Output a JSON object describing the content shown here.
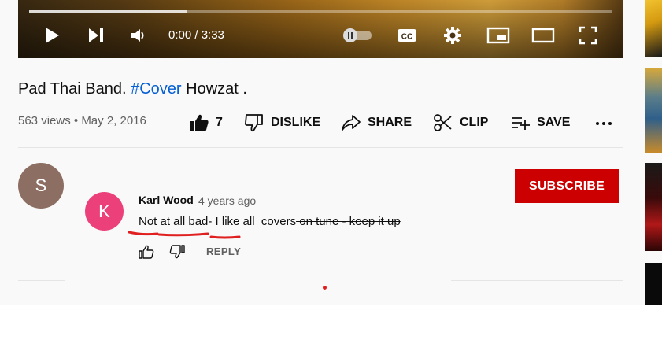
{
  "player": {
    "time_display": "0:00 / 3:33",
    "progress_fraction": 0.27,
    "controls": [
      "play-icon",
      "next-icon",
      "volume-icon",
      "autoplay-toggle",
      "captions-icon",
      "settings-gear-icon",
      "miniplayer-icon",
      "theater-mode-icon",
      "fullscreen-icon"
    ],
    "captions_label": "CC"
  },
  "video": {
    "title_prefix": "Pad Thai Band.",
    "hashtag": "#Cover",
    "title_suffix": "Howzat .",
    "views": "563 views",
    "separator": "•",
    "date": "May 2, 2016"
  },
  "actions": {
    "like_count": "7",
    "dislike_label": "DISLIKE",
    "share_label": "SHARE",
    "clip_label": "CLIP",
    "save_label": "SAVE"
  },
  "channel": {
    "avatar_letter": "S",
    "avatar_color": "#8d6e63",
    "subscribe_label": "SUBSCRIBE",
    "subscribe_color": "#cc0000"
  },
  "comment": {
    "avatar_letter": "K",
    "avatar_color": "#ec407a",
    "author": "Karl Wood",
    "time": "4 years ago",
    "text_plain": "Not at all bad- I like all  covers",
    "text_struck": " on tune - keep it up",
    "reply_label": "REPLY"
  },
  "colors": {
    "accent_red": "#cc0000",
    "hashtag_blue": "#065fd4",
    "annotation_red": "#e02020"
  }
}
